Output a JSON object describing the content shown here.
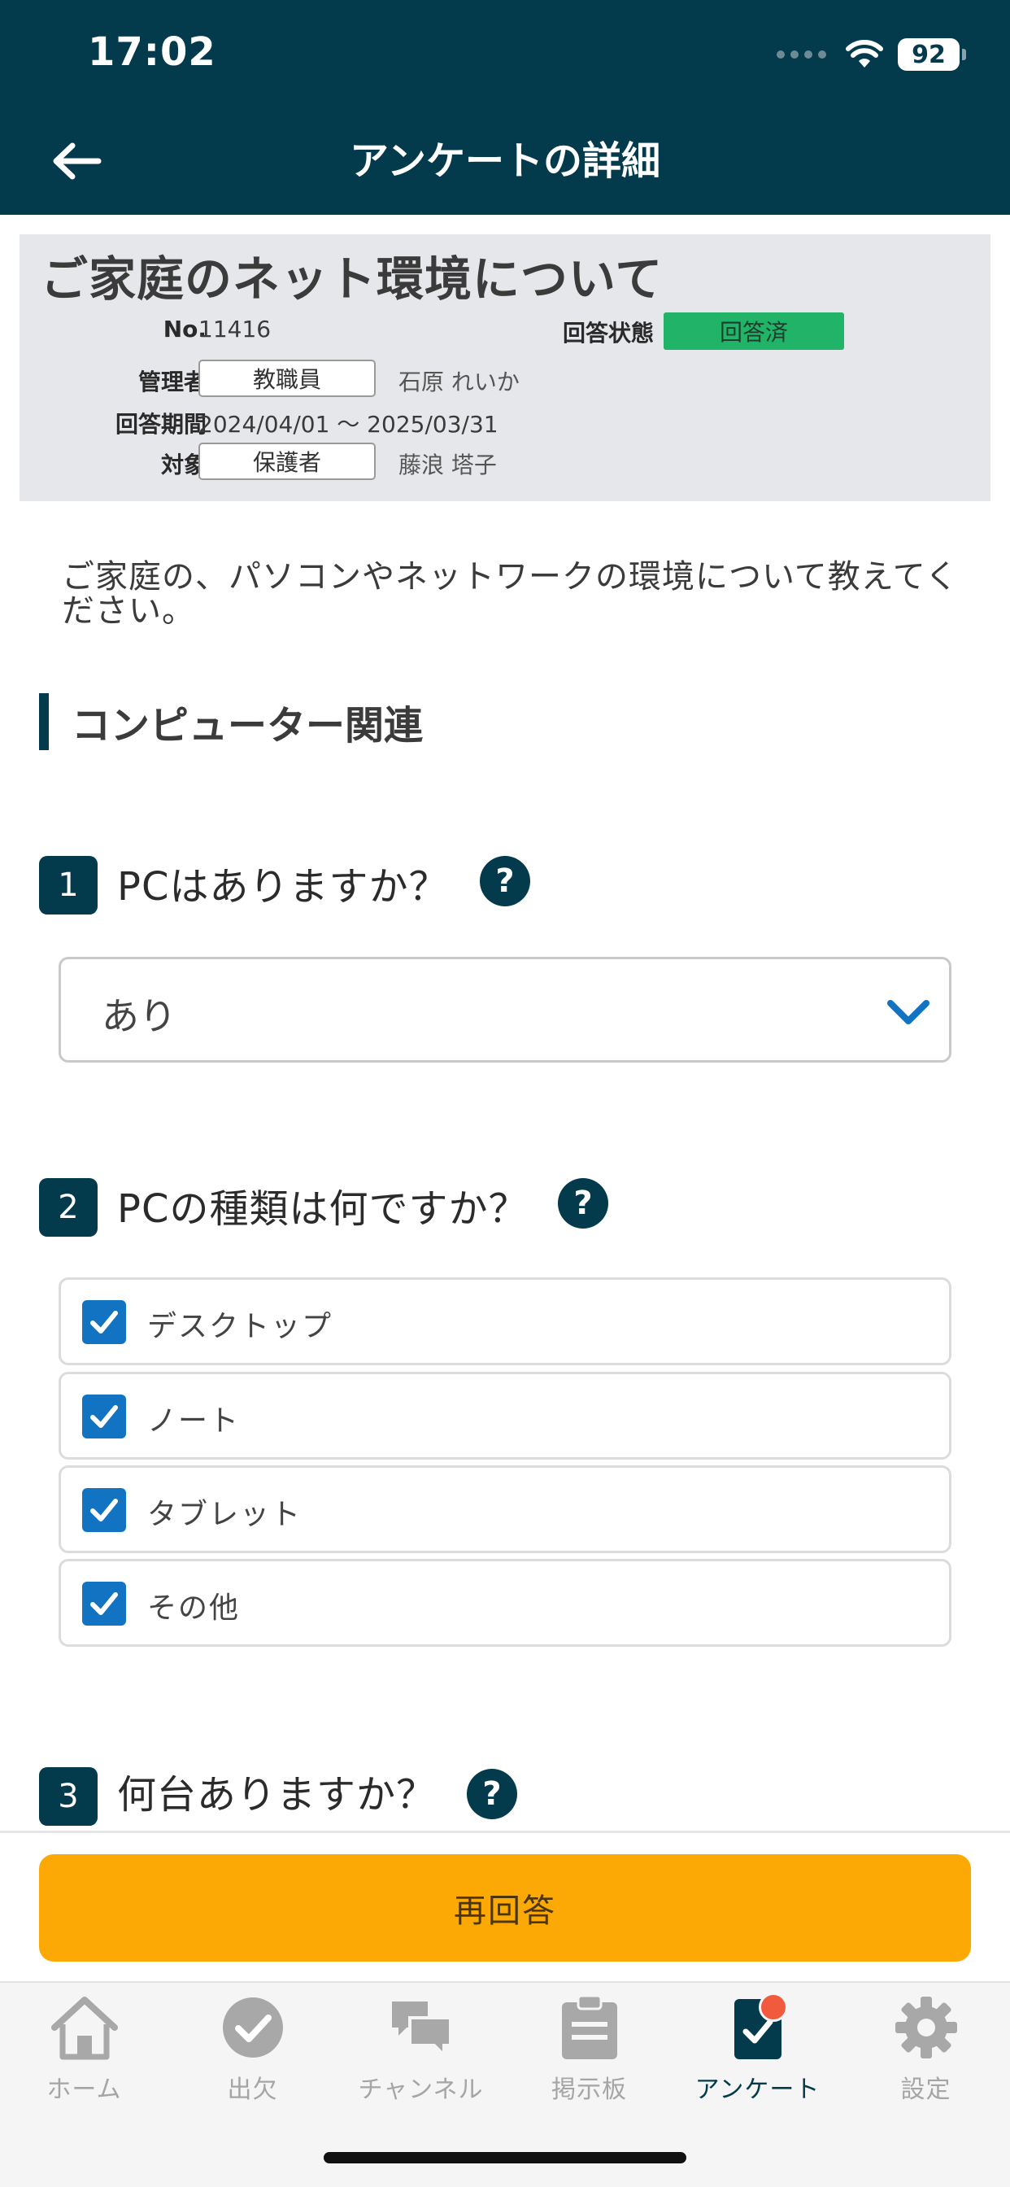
{
  "status_bar": {
    "time": "17:02",
    "battery": "92"
  },
  "header": {
    "title": "アンケートの詳細"
  },
  "survey": {
    "title": "ご家庭のネット環境について",
    "no_label": "No.",
    "no_value": "11416",
    "status_label": "回答状態",
    "status_value": "回答済",
    "manager_label": "管理者",
    "manager_role": "教職員",
    "manager_name": "石原 れいか",
    "period_label": "回答期間",
    "period_value": "2024/04/01 〜 2025/03/31",
    "target_label": "対象",
    "target_role": "保護者",
    "target_name": "藤浪 塔子",
    "description": "ご家庭の、パソコンやネットワークの環境について教えてください。"
  },
  "section": {
    "heading": "コンピューター関連"
  },
  "questions": [
    {
      "number": "1",
      "text": "PCはありますか？",
      "help": "?",
      "answer": "あり"
    },
    {
      "number": "2",
      "text": "PCの種類は何ですか？",
      "help": "?",
      "options": [
        {
          "label": "デスクトップ",
          "checked": true
        },
        {
          "label": "ノート",
          "checked": true
        },
        {
          "label": "タブレット",
          "checked": true
        },
        {
          "label": "その他",
          "checked": true
        }
      ]
    },
    {
      "number": "3",
      "text": "何台ありますか？",
      "help": "?"
    }
  ],
  "actions": {
    "reanswer_label": "再回答",
    "button_color": "#fca905"
  },
  "tabs": [
    {
      "label": "ホーム",
      "icon": "home-icon"
    },
    {
      "label": "出欠",
      "icon": "check-circle-icon"
    },
    {
      "label": "チャンネル",
      "icon": "chat-bubbles-icon"
    },
    {
      "label": "掲示板",
      "icon": "clipboard-icon"
    },
    {
      "label": "アンケート",
      "icon": "survey-icon",
      "active": true
    },
    {
      "label": "設定",
      "icon": "gear-icon"
    }
  ],
  "colors": {
    "primary": "#033b4c",
    "accent_blue": "#1273c2",
    "answered_green": "#21b469",
    "notification_red": "#f15a3c"
  }
}
